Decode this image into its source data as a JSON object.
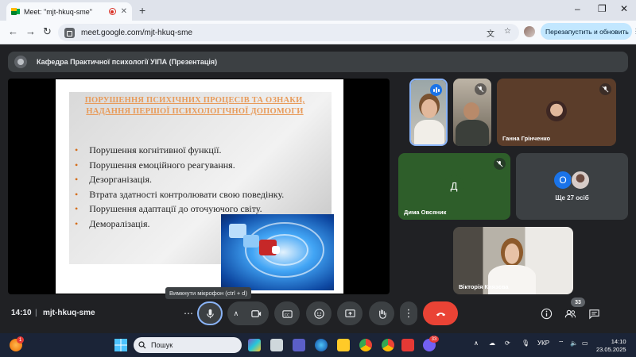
{
  "browser": {
    "tab_title": "Meet: \"mjt-hkuq-sme\"",
    "new_tab": "+",
    "url": "meet.google.com/mjt-hkuq-sme",
    "relaunch_label": "Перезапустить и обновить",
    "window_minimize": "–",
    "window_restore": "❐",
    "window_close": "✕"
  },
  "presentation": {
    "title": "Кафедра Практичної психології УІПА (Презентація)"
  },
  "slide": {
    "title": "Порушення психічних процесів та ознаки, надання першої психологічної допомоги",
    "bullets": [
      "Порушення когнітивної функції.",
      "Порушення емоційного реагування.",
      "Дезорганізація.",
      "Втрата здатності контролювати свою поведінку.",
      "Порушення адаптації до оточуючого світу.",
      "Деморалізація."
    ]
  },
  "participants": [
    {
      "name": "",
      "speaking": true
    },
    {
      "name": "",
      "muted": true
    },
    {
      "name": "Ганна Грінченко",
      "muted": true
    },
    {
      "name": "Дима Овсяник",
      "initial": "Д",
      "muted": true
    },
    {
      "name": "Вікторія Князєва"
    }
  ],
  "others": {
    "initial": "О",
    "label": "Ще 27 осіб"
  },
  "controls": {
    "time": "14:10",
    "separator": "|",
    "meeting_code": "mjt-hkuq-sme",
    "mic_tooltip": "Вимкнути мікрофон (ctrl + d)",
    "more_label": "⋯",
    "people_count": "33"
  },
  "taskbar": {
    "search_label": "Пошук",
    "language": "УКР",
    "time": "14:10",
    "date": "23.05.2025",
    "weather_badge": "1",
    "teams_badge": "33"
  },
  "colors": {
    "meet_bg": "#202124",
    "tile_green": "#2e5e2a",
    "tile_brown": "#5b3d2a",
    "hangup": "#ea4335",
    "accent": "#8ab4f8"
  }
}
